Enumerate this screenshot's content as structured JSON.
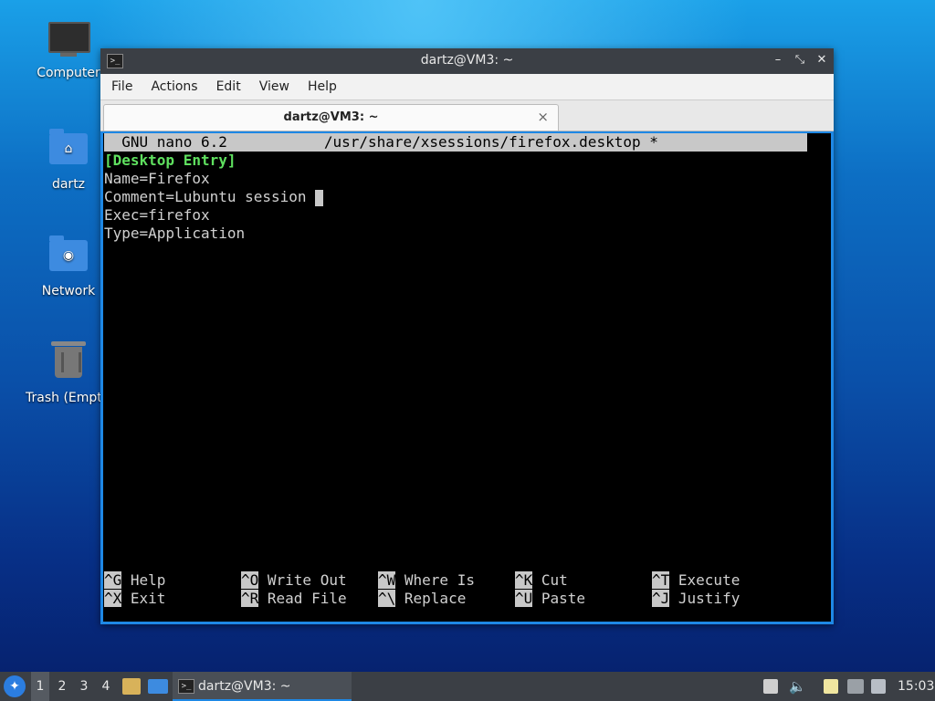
{
  "desktop": {
    "icons": [
      {
        "label": "Computer"
      },
      {
        "label": "dartz"
      },
      {
        "label": "Network"
      },
      {
        "label": "Trash (Empty)"
      }
    ]
  },
  "window": {
    "title": "dartz@VM3: ~",
    "menu": [
      "File",
      "Actions",
      "Edit",
      "View",
      "Help"
    ],
    "tab": {
      "label": "dartz@VM3: ~",
      "close": "×"
    }
  },
  "nano": {
    "header": "  GNU nano 6.2           /usr/share/xsessions/firefox.desktop *",
    "lines": [
      "[Desktop Entry]",
      "Name=Firefox",
      "Comment=Lubuntu session ",
      "Exec=firefox",
      "Type=Application"
    ],
    "shortcuts": [
      [
        {
          "key": "^G",
          "label": " Help"
        },
        {
          "key": "^X",
          "label": " Exit"
        }
      ],
      [
        {
          "key": "^O",
          "label": " Write Out"
        },
        {
          "key": "^R",
          "label": " Read File"
        }
      ],
      [
        {
          "key": "^W",
          "label": " Where Is"
        },
        {
          "key": "^\\",
          "label": " Replace"
        }
      ],
      [
        {
          "key": "^K",
          "label": " Cut"
        },
        {
          "key": "^U",
          "label": " Paste"
        }
      ],
      [
        {
          "key": "^T",
          "label": " Execute"
        },
        {
          "key": "^J",
          "label": " Justify"
        }
      ]
    ]
  },
  "taskbar": {
    "desktops": [
      "1",
      "2",
      "3",
      "4"
    ],
    "task_label": "dartz@VM3: ~",
    "clock": "15:03"
  }
}
